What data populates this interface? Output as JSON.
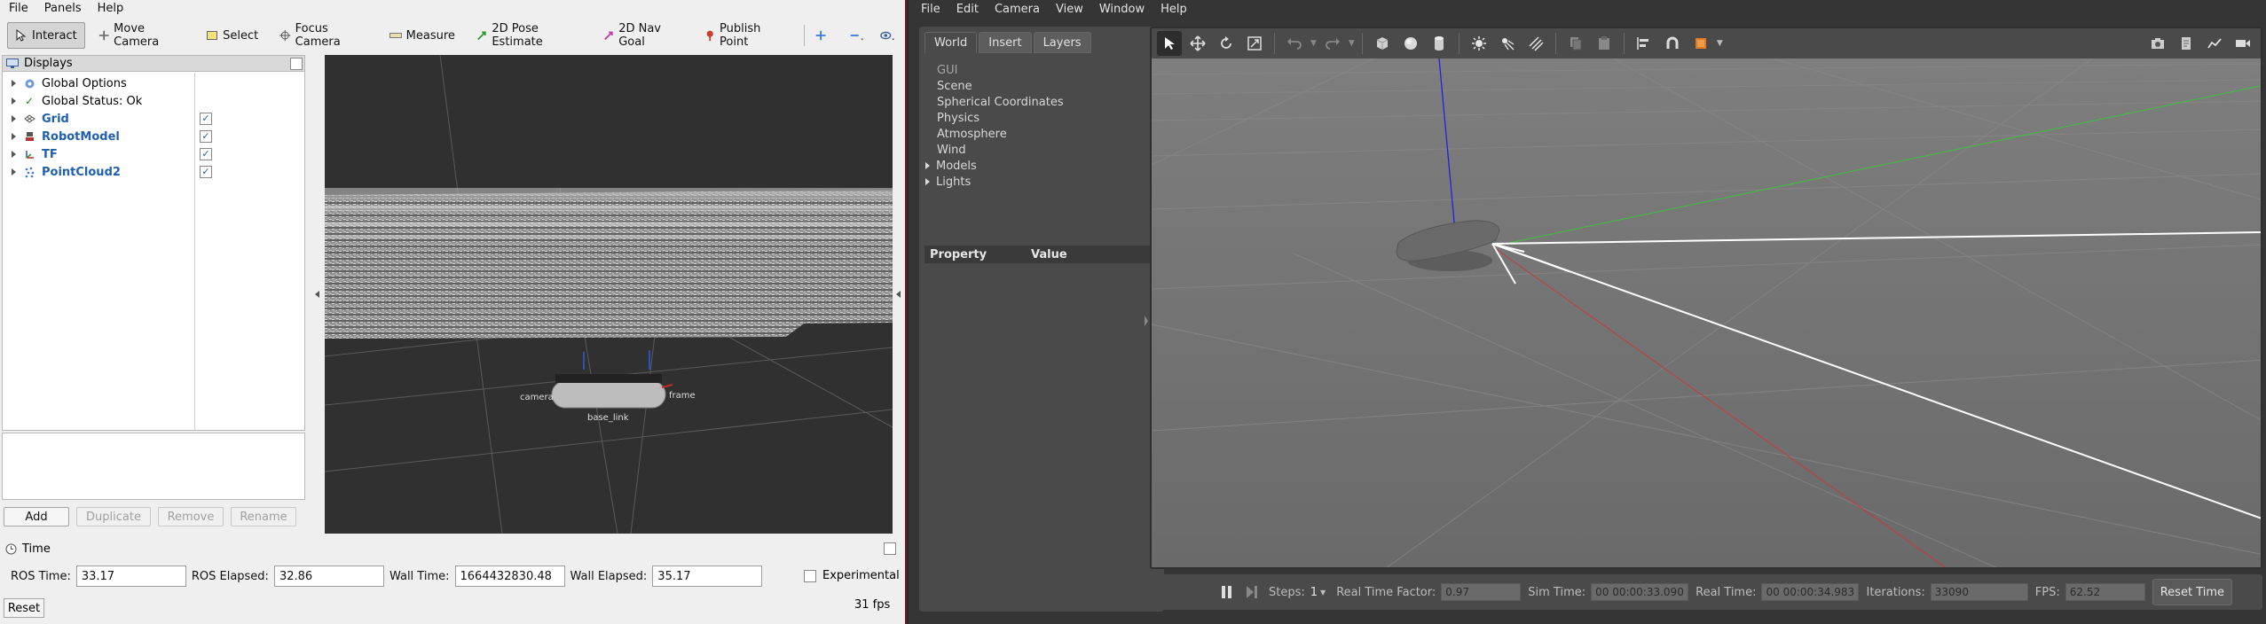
{
  "rviz": {
    "menu": [
      "File",
      "Panels",
      "Help"
    ],
    "tools": [
      {
        "label": "Interact",
        "icon": "cursor-icon"
      },
      {
        "label": "Move Camera",
        "icon": "move-camera-icon"
      },
      {
        "label": "Select",
        "icon": "select-icon"
      },
      {
        "label": "Focus Camera",
        "icon": "focus-camera-icon"
      },
      {
        "label": "Measure",
        "icon": "ruler-icon"
      },
      {
        "label": "2D Pose Estimate",
        "icon": "pose-arrow-icon"
      },
      {
        "label": "2D Nav Goal",
        "icon": "nav-goal-icon"
      },
      {
        "label": "Publish Point",
        "icon": "pin-icon"
      }
    ],
    "displays": {
      "title": "Displays",
      "items": [
        {
          "label": "Global Options",
          "icon": "gear-icon",
          "checked": null
        },
        {
          "label": "Global Status: Ok",
          "icon": "check-icon",
          "checked": null
        },
        {
          "label": "Grid",
          "icon": "grid-icon",
          "checked": "✓"
        },
        {
          "label": "RobotModel",
          "icon": "robot-icon",
          "checked": "✓"
        },
        {
          "label": "TF",
          "icon": "tf-axes-icon",
          "checked": "✓"
        },
        {
          "label": "PointCloud2",
          "icon": "pointcloud-icon",
          "checked": "✓"
        }
      ]
    },
    "buttons": {
      "add": "Add",
      "duplicate": "Duplicate",
      "remove": "Remove",
      "rename": "Rename"
    },
    "view_labels": {
      "camera": "camera",
      "base_link": "base_link",
      "frame": "frame"
    },
    "time": {
      "title": "Time",
      "ros_time_label": "ROS Time:",
      "ros_time": "33.17",
      "ros_elapsed_label": "ROS Elapsed:",
      "ros_elapsed": "32.86",
      "wall_time_label": "Wall Time:",
      "wall_time": "1664432830.48",
      "wall_elapsed_label": "Wall Elapsed:",
      "wall_elapsed": "35.17",
      "experimental": "Experimental",
      "reset": "Reset",
      "fps": "31 fps"
    }
  },
  "gazebo": {
    "menu": [
      "File",
      "Edit",
      "Camera",
      "View",
      "Window",
      "Help"
    ],
    "tabs": [
      "World",
      "Insert",
      "Layers"
    ],
    "tree": [
      "GUI",
      "Scene",
      "Spherical Coordinates",
      "Physics",
      "Atmosphere",
      "Wind",
      "Models",
      "Lights"
    ],
    "property_header": {
      "property": "Property",
      "value": "Value"
    },
    "bottom": {
      "steps_label": "Steps:",
      "steps": "1",
      "rtf_label": "Real Time Factor:",
      "rtf": "0.97",
      "sim_time_label": "Sim Time:",
      "sim_time": "00 00:00:33.090",
      "real_time_label": "Real Time:",
      "real_time": "00 00:00:34.983",
      "iterations_label": "Iterations:",
      "iterations": "33090",
      "fps_label": "FPS:",
      "fps": "62.52",
      "reset_time": "Reset Time"
    }
  }
}
